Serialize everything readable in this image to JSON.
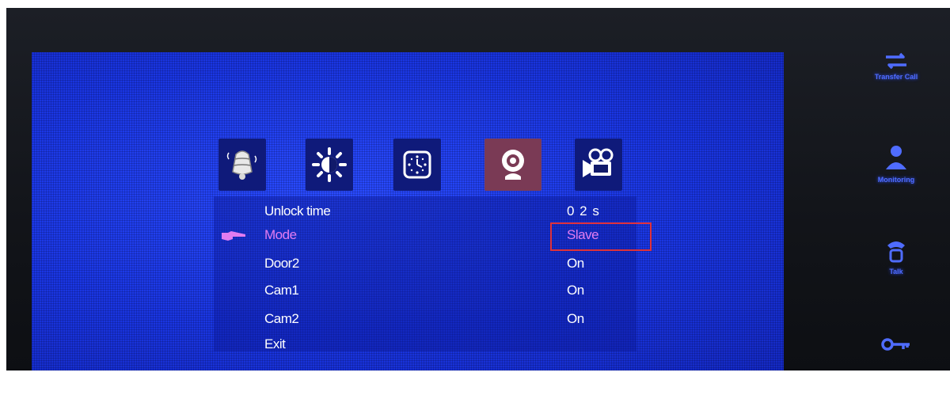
{
  "tabs": [
    {
      "name": "ringtone",
      "icon": "bell-icon",
      "active": false
    },
    {
      "name": "brightness",
      "icon": "brightness-icon",
      "active": false
    },
    {
      "name": "clock",
      "icon": "clock-icon",
      "active": false
    },
    {
      "name": "camera",
      "icon": "webcam-icon",
      "active": true
    },
    {
      "name": "video",
      "icon": "video-camera-icon",
      "active": false
    }
  ],
  "menu": {
    "items": [
      {
        "label": "Unlock time",
        "value": "0 2 s",
        "selected": false
      },
      {
        "label": "Mode",
        "value": "Slave",
        "selected": true
      },
      {
        "label": "Door2",
        "value": "On",
        "selected": false
      },
      {
        "label": "Cam1",
        "value": "On",
        "selected": false
      },
      {
        "label": "Cam2",
        "value": "On",
        "selected": false
      },
      {
        "label": "Exit",
        "value": "",
        "selected": false
      }
    ]
  },
  "side_buttons": [
    {
      "icon": "transfer-icon",
      "label": "Transfer Call"
    },
    {
      "icon": "monitor-person-icon",
      "label": "Monitoring"
    },
    {
      "icon": "phone-icon",
      "label": "Talk"
    },
    {
      "icon": "key-icon",
      "label": ""
    }
  ],
  "colors": {
    "screen_blue": "#1a36e2",
    "selected_text": "#e27cf0",
    "highlight_red": "#e0323c",
    "active_tab": "#7a3a55",
    "side_button_blue": "#4f6cff"
  }
}
